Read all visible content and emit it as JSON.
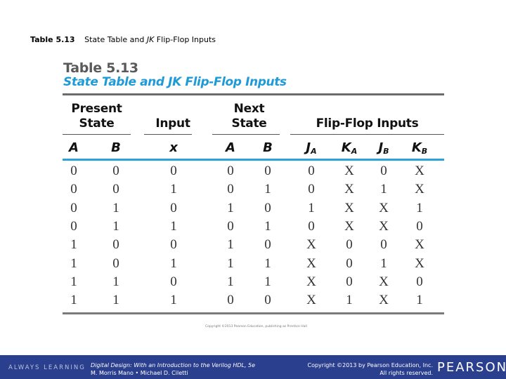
{
  "slide": {
    "caption_number": "Table 5.13",
    "caption_text_pre": "State Table and ",
    "caption_text_italic": "JK",
    "caption_text_post": " Flip-Flop Inputs"
  },
  "table": {
    "label": "Table 5.13",
    "title": "State Table and JK Flip-Flop Inputs",
    "groups": [
      {
        "line1": "Present",
        "line2": "State"
      },
      {
        "line1": "",
        "line2": "Input"
      },
      {
        "line1": "Next",
        "line2": "State"
      },
      {
        "line1": "",
        "line2": "Flip-Flop Inputs"
      }
    ],
    "columns": [
      {
        "main": "A",
        "sub": ""
      },
      {
        "main": "B",
        "sub": ""
      },
      {
        "main": "x",
        "sub": ""
      },
      {
        "main": "A",
        "sub": ""
      },
      {
        "main": "B",
        "sub": ""
      },
      {
        "main": "J",
        "sub": "A"
      },
      {
        "main": "K",
        "sub": "A"
      },
      {
        "main": "J",
        "sub": "B"
      },
      {
        "main": "K",
        "sub": "B"
      }
    ],
    "rows": [
      [
        "0",
        "0",
        "0",
        "0",
        "0",
        "0",
        "X",
        "0",
        "X"
      ],
      [
        "0",
        "0",
        "1",
        "0",
        "1",
        "0",
        "X",
        "1",
        "X"
      ],
      [
        "0",
        "1",
        "0",
        "1",
        "0",
        "1",
        "X",
        "X",
        "1"
      ],
      [
        "0",
        "1",
        "1",
        "0",
        "1",
        "0",
        "X",
        "X",
        "0"
      ],
      [
        "1",
        "0",
        "0",
        "1",
        "0",
        "X",
        "0",
        "0",
        "X"
      ],
      [
        "1",
        "0",
        "1",
        "1",
        "1",
        "X",
        "0",
        "1",
        "X"
      ],
      [
        "1",
        "1",
        "0",
        "1",
        "1",
        "X",
        "0",
        "X",
        "0"
      ],
      [
        "1",
        "1",
        "1",
        "0",
        "0",
        "X",
        "1",
        "X",
        "1"
      ]
    ],
    "copyright_small": "Copyright ©2013 Pearson Education, publishing as Prentice Hall"
  },
  "footer": {
    "tagline": "ALWAYS LEARNING",
    "book_title": "Digital Design: With an Introduction to the Verilog HDL, 5e",
    "authors": "M. Morris Mano • Michael D. Ciletti",
    "copyright_line1": "Copyright ©2013 by Pearson Education, Inc.",
    "copyright_line2": "All rights reserved.",
    "logo": "PEARSON"
  },
  "colors": {
    "title_blue": "#1e9bd7",
    "header_rule_blue": "#2aa3d6",
    "footer_bg": "#2b3f8f"
  }
}
